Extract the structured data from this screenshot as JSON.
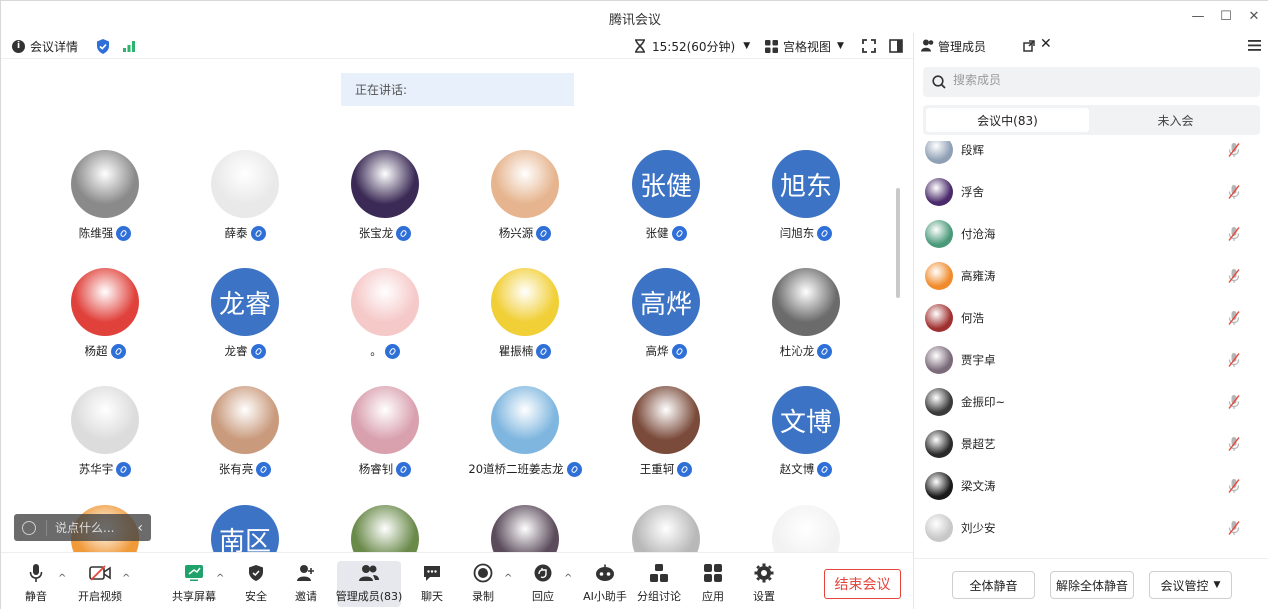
{
  "window": {
    "title": "腾讯会议"
  },
  "topbar": {
    "meeting_info": "会议详情",
    "time": "15:52(60分钟)",
    "view": "宫格视图"
  },
  "main": {
    "speaking_label": "正在讲话:",
    "chat_placeholder": "说点什么..."
  },
  "participants": [
    {
      "name": "陈维强",
      "avatar": "photo",
      "color": "#8a8a8a"
    },
    {
      "name": "薛泰",
      "avatar": "photo",
      "color": "#e9e9e9"
    },
    {
      "name": "张宝龙",
      "avatar": "photo",
      "color": "#3a2a55"
    },
    {
      "name": "杨兴源",
      "avatar": "photo",
      "color": "#e6b48e"
    },
    {
      "name": "张健",
      "avatar": "text",
      "text": "张健"
    },
    {
      "name": "闫旭东",
      "avatar": "text",
      "text": "旭东"
    },
    {
      "name": "杨超",
      "avatar": "photo",
      "color": "#e0413b"
    },
    {
      "name": "龙睿",
      "avatar": "text",
      "text": "龙睿"
    },
    {
      "name": "。",
      "avatar": "photo",
      "color": "#f6c9c9"
    },
    {
      "name": "瞿振楠",
      "avatar": "photo",
      "color": "#f1cf37"
    },
    {
      "name": "高烨",
      "avatar": "text",
      "text": "高烨"
    },
    {
      "name": "杜沁龙",
      "avatar": "photo",
      "color": "#6b6b6b"
    },
    {
      "name": "苏华宇",
      "avatar": "photo",
      "color": "#dcdcdc"
    },
    {
      "name": "张有亮",
      "avatar": "photo",
      "color": "#c99a7c"
    },
    {
      "name": "杨睿钊",
      "avatar": "photo",
      "color": "#d9a0ae"
    },
    {
      "name": "20道桥二班姜志龙",
      "avatar": "photo",
      "color": "#7fb6df"
    },
    {
      "name": "王重轲",
      "avatar": "photo",
      "color": "#7a4a3a"
    },
    {
      "name": "赵文博",
      "avatar": "text",
      "text": "文博"
    },
    {
      "name": "",
      "avatar": "photo",
      "color": "#f09a3a"
    },
    {
      "name": "",
      "avatar": "text",
      "text": "南区"
    },
    {
      "name": "",
      "avatar": "photo",
      "color": "#6a8a4a"
    },
    {
      "name": "",
      "avatar": "photo",
      "color": "#5b4b5b"
    },
    {
      "name": "",
      "avatar": "photo",
      "color": "#b8b8b8"
    },
    {
      "name": "",
      "avatar": "photo",
      "color": "#f2f2f2"
    }
  ],
  "toolbar": {
    "mute": "静音",
    "video": "开启视频",
    "share": "共享屏幕",
    "security": "安全",
    "invite": "邀请",
    "members": "管理成员(83)",
    "chat": "聊天",
    "record": "录制",
    "react": "回应",
    "ai": "AI小助手",
    "breakout": "分组讨论",
    "apps": "应用",
    "settings": "设置",
    "end": "结束会议"
  },
  "panel": {
    "title": "管理成员",
    "search_placeholder": "搜索成员",
    "tab_in": "会议中(83)",
    "tab_out": "未入会",
    "members": [
      {
        "name": "段辉",
        "color": "#8fa0b5"
      },
      {
        "name": "浮舍",
        "color": "#4a2a6a"
      },
      {
        "name": "付沧海",
        "color": "#4a9a7a"
      },
      {
        "name": "高雍涛",
        "color": "#f08a2a"
      },
      {
        "name": "何浩",
        "color": "#a03030"
      },
      {
        "name": "贾宇卓",
        "color": "#7a6a7a"
      },
      {
        "name": "金振印~",
        "color": "#3a3a3a"
      },
      {
        "name": "景超艺",
        "color": "#2a2a2a"
      },
      {
        "name": "梁文涛",
        "color": "#1a1a1a"
      },
      {
        "name": "刘少安",
        "color": "#c8c8c8"
      }
    ],
    "mute_all": "全体静音",
    "unmute_all": "解除全体静音",
    "control": "会议管控"
  },
  "colors": {
    "accent": "#2f6fd8",
    "avatar_blue": "#3c73c4",
    "danger": "#e5443b"
  }
}
